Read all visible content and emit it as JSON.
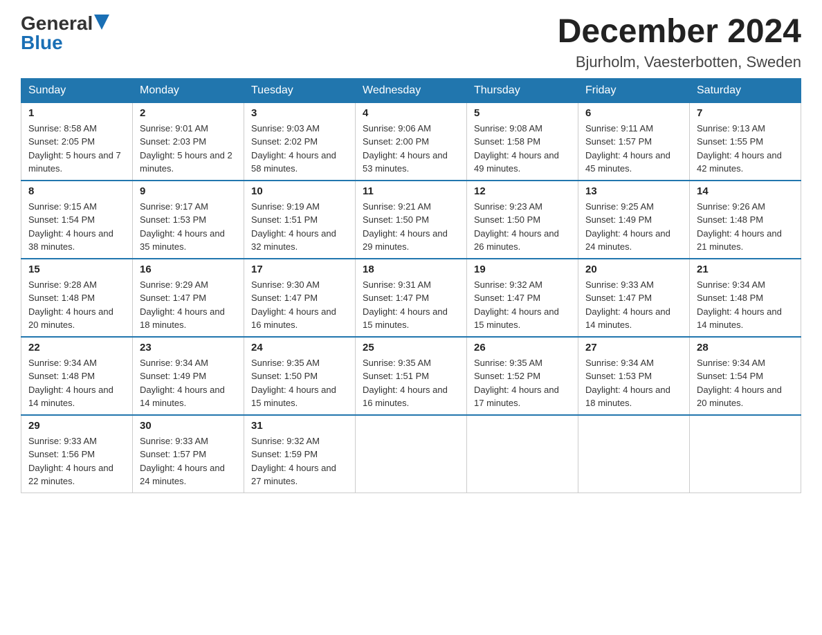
{
  "header": {
    "logo_general": "General",
    "logo_blue": "Blue",
    "month_year": "December 2024",
    "location": "Bjurholm, Vaesterbotten, Sweden"
  },
  "weekdays": [
    "Sunday",
    "Monday",
    "Tuesday",
    "Wednesday",
    "Thursday",
    "Friday",
    "Saturday"
  ],
  "weeks": [
    [
      {
        "day": "1",
        "sunrise": "8:58 AM",
        "sunset": "2:05 PM",
        "daylight": "5 hours and 7 minutes."
      },
      {
        "day": "2",
        "sunrise": "9:01 AM",
        "sunset": "2:03 PM",
        "daylight": "5 hours and 2 minutes."
      },
      {
        "day": "3",
        "sunrise": "9:03 AM",
        "sunset": "2:02 PM",
        "daylight": "4 hours and 58 minutes."
      },
      {
        "day": "4",
        "sunrise": "9:06 AM",
        "sunset": "2:00 PM",
        "daylight": "4 hours and 53 minutes."
      },
      {
        "day": "5",
        "sunrise": "9:08 AM",
        "sunset": "1:58 PM",
        "daylight": "4 hours and 49 minutes."
      },
      {
        "day": "6",
        "sunrise": "9:11 AM",
        "sunset": "1:57 PM",
        "daylight": "4 hours and 45 minutes."
      },
      {
        "day": "7",
        "sunrise": "9:13 AM",
        "sunset": "1:55 PM",
        "daylight": "4 hours and 42 minutes."
      }
    ],
    [
      {
        "day": "8",
        "sunrise": "9:15 AM",
        "sunset": "1:54 PM",
        "daylight": "4 hours and 38 minutes."
      },
      {
        "day": "9",
        "sunrise": "9:17 AM",
        "sunset": "1:53 PM",
        "daylight": "4 hours and 35 minutes."
      },
      {
        "day": "10",
        "sunrise": "9:19 AM",
        "sunset": "1:51 PM",
        "daylight": "4 hours and 32 minutes."
      },
      {
        "day": "11",
        "sunrise": "9:21 AM",
        "sunset": "1:50 PM",
        "daylight": "4 hours and 29 minutes."
      },
      {
        "day": "12",
        "sunrise": "9:23 AM",
        "sunset": "1:50 PM",
        "daylight": "4 hours and 26 minutes."
      },
      {
        "day": "13",
        "sunrise": "9:25 AM",
        "sunset": "1:49 PM",
        "daylight": "4 hours and 24 minutes."
      },
      {
        "day": "14",
        "sunrise": "9:26 AM",
        "sunset": "1:48 PM",
        "daylight": "4 hours and 21 minutes."
      }
    ],
    [
      {
        "day": "15",
        "sunrise": "9:28 AM",
        "sunset": "1:48 PM",
        "daylight": "4 hours and 20 minutes."
      },
      {
        "day": "16",
        "sunrise": "9:29 AM",
        "sunset": "1:47 PM",
        "daylight": "4 hours and 18 minutes."
      },
      {
        "day": "17",
        "sunrise": "9:30 AM",
        "sunset": "1:47 PM",
        "daylight": "4 hours and 16 minutes."
      },
      {
        "day": "18",
        "sunrise": "9:31 AM",
        "sunset": "1:47 PM",
        "daylight": "4 hours and 15 minutes."
      },
      {
        "day": "19",
        "sunrise": "9:32 AM",
        "sunset": "1:47 PM",
        "daylight": "4 hours and 15 minutes."
      },
      {
        "day": "20",
        "sunrise": "9:33 AM",
        "sunset": "1:47 PM",
        "daylight": "4 hours and 14 minutes."
      },
      {
        "day": "21",
        "sunrise": "9:34 AM",
        "sunset": "1:48 PM",
        "daylight": "4 hours and 14 minutes."
      }
    ],
    [
      {
        "day": "22",
        "sunrise": "9:34 AM",
        "sunset": "1:48 PM",
        "daylight": "4 hours and 14 minutes."
      },
      {
        "day": "23",
        "sunrise": "9:34 AM",
        "sunset": "1:49 PM",
        "daylight": "4 hours and 14 minutes."
      },
      {
        "day": "24",
        "sunrise": "9:35 AM",
        "sunset": "1:50 PM",
        "daylight": "4 hours and 15 minutes."
      },
      {
        "day": "25",
        "sunrise": "9:35 AM",
        "sunset": "1:51 PM",
        "daylight": "4 hours and 16 minutes."
      },
      {
        "day": "26",
        "sunrise": "9:35 AM",
        "sunset": "1:52 PM",
        "daylight": "4 hours and 17 minutes."
      },
      {
        "day": "27",
        "sunrise": "9:34 AM",
        "sunset": "1:53 PM",
        "daylight": "4 hours and 18 minutes."
      },
      {
        "day": "28",
        "sunrise": "9:34 AM",
        "sunset": "1:54 PM",
        "daylight": "4 hours and 20 minutes."
      }
    ],
    [
      {
        "day": "29",
        "sunrise": "9:33 AM",
        "sunset": "1:56 PM",
        "daylight": "4 hours and 22 minutes."
      },
      {
        "day": "30",
        "sunrise": "9:33 AM",
        "sunset": "1:57 PM",
        "daylight": "4 hours and 24 minutes."
      },
      {
        "day": "31",
        "sunrise": "9:32 AM",
        "sunset": "1:59 PM",
        "daylight": "4 hours and 27 minutes."
      },
      null,
      null,
      null,
      null
    ]
  ]
}
